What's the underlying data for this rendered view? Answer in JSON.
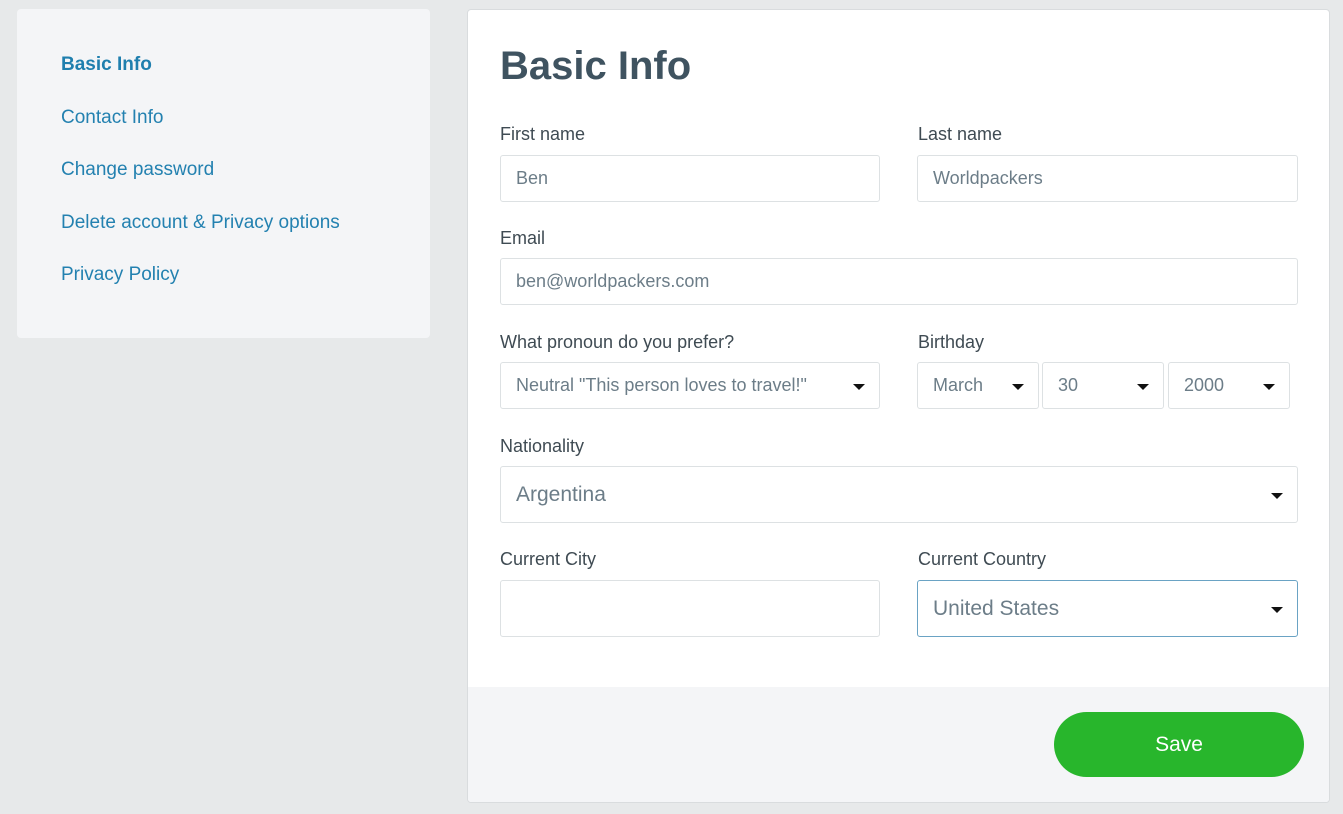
{
  "sidebar": {
    "items": [
      {
        "label": "Basic Info",
        "active": true
      },
      {
        "label": "Contact Info"
      },
      {
        "label": "Change password"
      },
      {
        "label": "Delete account & Privacy options"
      },
      {
        "label": "Privacy Policy"
      }
    ]
  },
  "form": {
    "title": "Basic Info",
    "first_name": {
      "label": "First name",
      "value": "Ben"
    },
    "last_name": {
      "label": "Last name",
      "value": "Worldpackers"
    },
    "email": {
      "label": "Email",
      "value": "ben@worldpackers.com"
    },
    "pronoun": {
      "label": "What pronoun do you prefer?",
      "value": "Neutral \"This person loves to travel!\""
    },
    "birthday": {
      "label": "Birthday",
      "month": "March",
      "day": "30",
      "year": "2000"
    },
    "nationality": {
      "label": "Nationality",
      "value": "Argentina"
    },
    "current_city": {
      "label": "Current City",
      "value": ""
    },
    "current_country": {
      "label": "Current Country",
      "value": "United States"
    }
  },
  "footer": {
    "save_label": "Save"
  },
  "colors": {
    "accent": "#2381b0",
    "save": "#28b62c",
    "title": "#3f5360"
  }
}
